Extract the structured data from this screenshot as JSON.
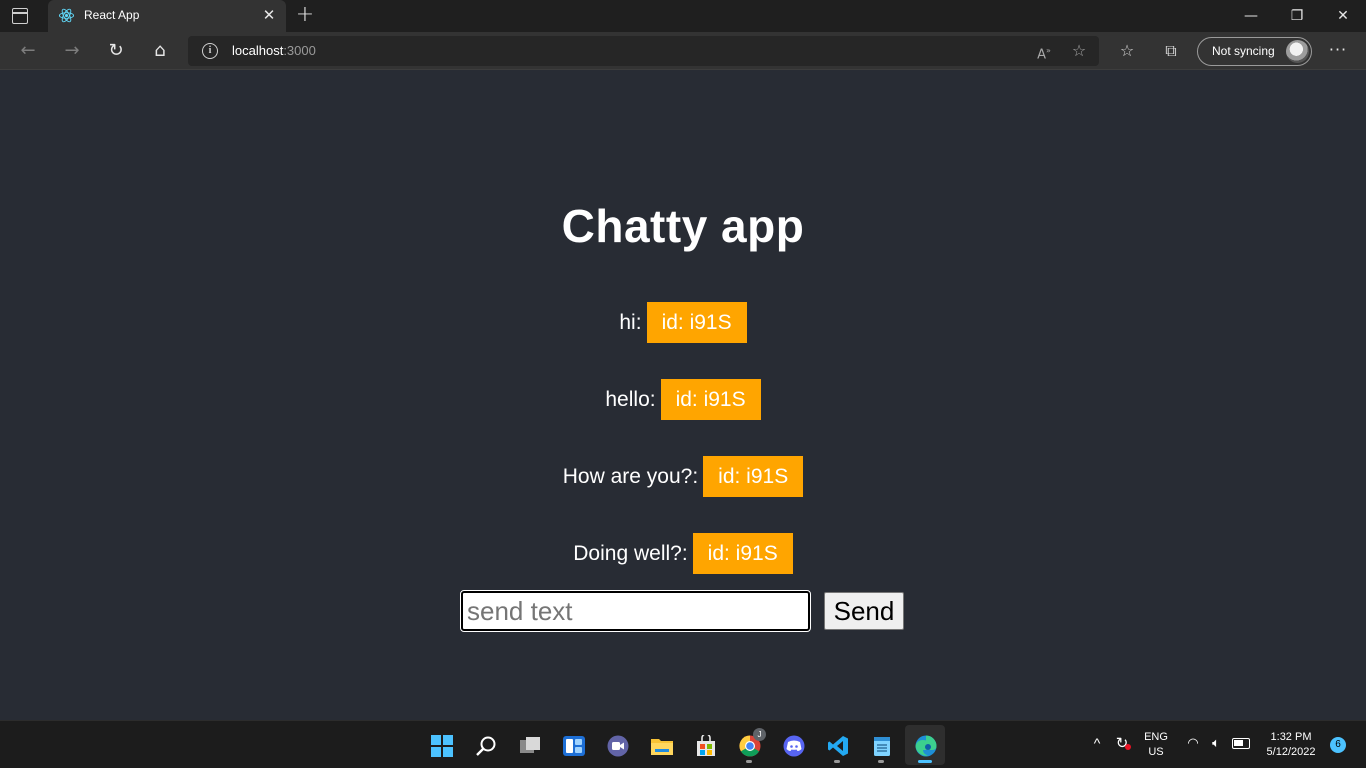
{
  "browser": {
    "tab_title": "React App",
    "url_host": "localhost",
    "url_port": ":3000",
    "sync_label": "Not syncing",
    "accent": "#4cc2ff"
  },
  "app": {
    "title": "Chatty app",
    "messages": [
      {
        "text": "hi:",
        "id_label": "id: i91S"
      },
      {
        "text": "hello:",
        "id_label": "id: i91S"
      },
      {
        "text": "How are you?:",
        "id_label": "id: i91S"
      },
      {
        "text": "Doing well?:",
        "id_label": "id: i91S"
      }
    ],
    "input_placeholder": "send text",
    "send_label": "Send",
    "id_badge_color": "#ffa500",
    "background_color": "#282c34"
  },
  "taskbar": {
    "apps": [
      "start-icon",
      "search-icon",
      "task-view-icon",
      "widgets-icon",
      "teams-chat-icon",
      "file-explorer-icon",
      "store-icon",
      "chrome-icon",
      "discord-icon",
      "vscode-icon",
      "notepad-icon",
      "edge-icon"
    ],
    "language_line1": "ENG",
    "language_line2": "US",
    "time": "1:32 PM",
    "date": "5/12/2022",
    "notification_count": "6",
    "chrome_badge": "J"
  }
}
